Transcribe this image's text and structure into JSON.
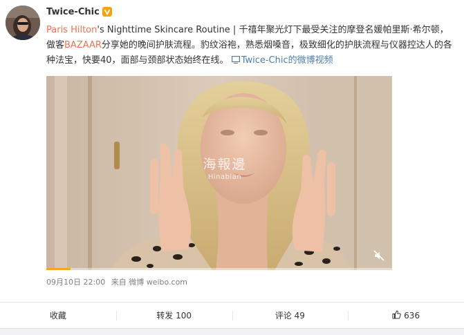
{
  "post": {
    "author": "Twice-Chic",
    "verified_icon": "verified-badge-icon",
    "text": {
      "part1": "Paris Hilton",
      "part2": "'s Nighttime Skincare Routine | 千禧年聚光灯下最受关注的摩登名媛帕里斯·希尔顿，做客",
      "part3": "BAZAAR",
      "part4": "分享她的晚间护肤流程。豹纹浴袍，熟悉烟嗓音，极致细化的护肤流程与仪器控达人的各种法宝，快要40，面部与颈部状态始终在线。",
      "video_link": "Twice-Chic的微博视频"
    },
    "video": {
      "watermark_cn": "海報邊",
      "watermark_en": "Hinabian",
      "progress": 0.07,
      "mute_icon": "muted-speaker-icon"
    },
    "meta": {
      "time": "09月10日 22:00",
      "source": "来自 微博 weibo.com"
    },
    "actions": {
      "favorite": "收藏",
      "repost": "转发 100",
      "comment": "评论 49",
      "like_count": "636",
      "like_icon": "thumbs-up-icon"
    }
  },
  "colors": {
    "link": "#eb7350",
    "video_link": "#507daf",
    "progress": "#f5a623",
    "verified": "#f7a10b"
  }
}
